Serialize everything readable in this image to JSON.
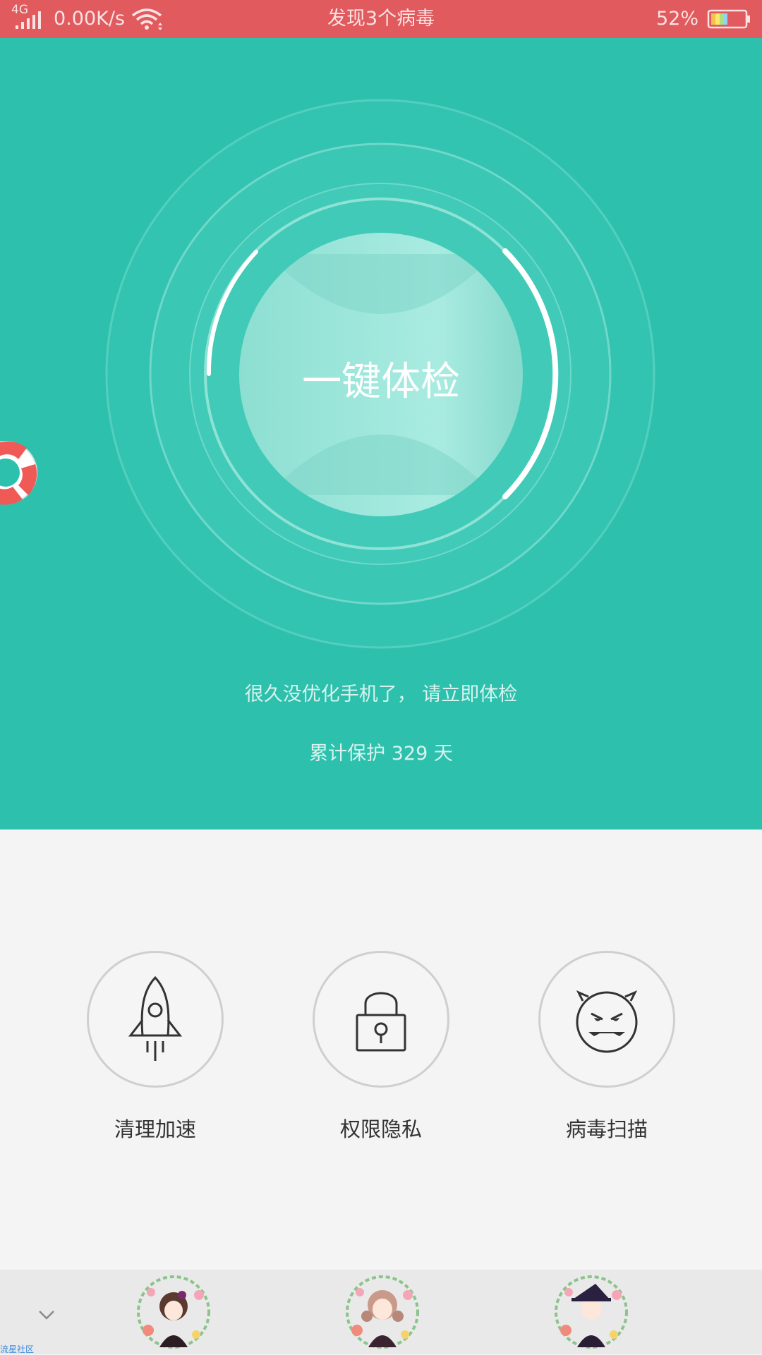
{
  "status_bar": {
    "network": "4G",
    "speed": "0.00K/s",
    "notice": "发现3个病毒",
    "battery": "52%",
    "icons": [
      "signal-icon",
      "wifi-icon",
      "battery-icon"
    ]
  },
  "hero": {
    "scan_button_label": "一键体检",
    "hint": "很久没优化手机了， 请立即体检",
    "protect_text": "累计保护 329 天",
    "colors": {
      "background": "#2dc1ad",
      "accent": "#e05a5e"
    },
    "floating_icon": "lifebuoy-icon"
  },
  "tools": [
    {
      "label": "清理加速",
      "icon": "rocket-icon"
    },
    {
      "label": "权限隐私",
      "icon": "lock-icon"
    },
    {
      "label": "病毒扫描",
      "icon": "virus-face-icon"
    }
  ],
  "bottom_bar": {
    "collapse_icon": "chevron-down-icon",
    "avatars": [
      "avatar-girl-1",
      "avatar-girl-2",
      "avatar-girl-3"
    ],
    "community_text": "流星社区"
  }
}
